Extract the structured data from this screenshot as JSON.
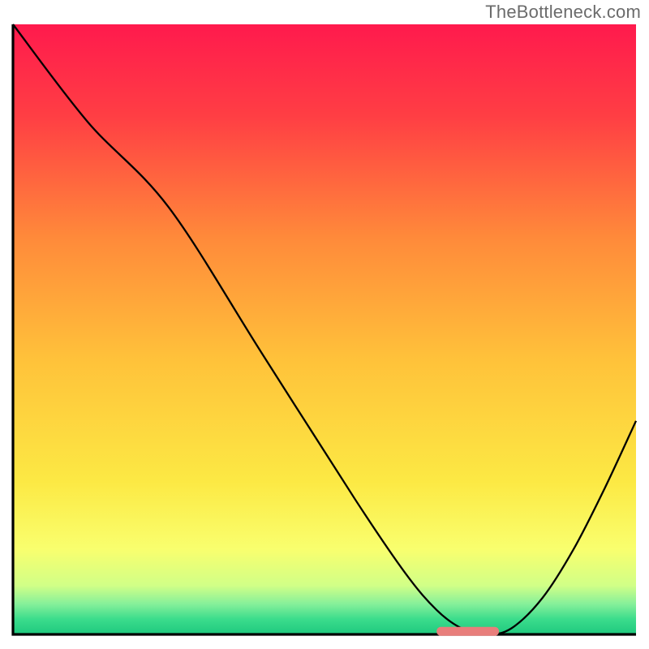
{
  "watermark": "TheBottleneck.com",
  "chart_data": {
    "type": "line",
    "title": "",
    "xlabel": "",
    "ylabel": "",
    "xlim": [
      0,
      100
    ],
    "ylim": [
      0,
      100
    ],
    "grid": false,
    "legend": false,
    "annotations": [],
    "series": [
      {
        "name": "bottleneck-curve",
        "x": [
          0,
          12,
          25,
          40,
          55,
          63,
          68,
          72,
          76,
          80,
          85,
          90,
          95,
          100
        ],
        "y": [
          100,
          84,
          70,
          46,
          22,
          10,
          4,
          1,
          0,
          1,
          6,
          14,
          24,
          35
        ]
      }
    ],
    "marker": {
      "name": "optimal-range",
      "x_start": 68,
      "x_end": 78,
      "y": 0.5,
      "color": "#e87e7b"
    },
    "background_gradient": {
      "stops": [
        {
          "offset": 0.0,
          "color": "#ff1a4d"
        },
        {
          "offset": 0.15,
          "color": "#ff3e44"
        },
        {
          "offset": 0.35,
          "color": "#ff8a3a"
        },
        {
          "offset": 0.55,
          "color": "#ffc23a"
        },
        {
          "offset": 0.75,
          "color": "#fce944"
        },
        {
          "offset": 0.86,
          "color": "#f9ff6e"
        },
        {
          "offset": 0.92,
          "color": "#d1ff87"
        },
        {
          "offset": 0.95,
          "color": "#86f09a"
        },
        {
          "offset": 0.975,
          "color": "#3bdc8c"
        },
        {
          "offset": 1.0,
          "color": "#1fc97e"
        }
      ]
    }
  }
}
